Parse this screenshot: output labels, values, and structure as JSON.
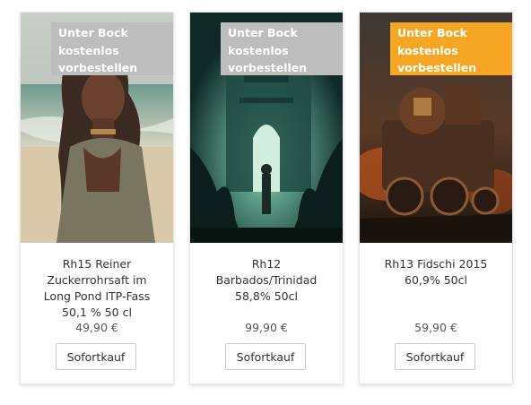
{
  "products": [
    {
      "badge_lines": [
        "Unter Bock",
        "kostenlos",
        "vorbestellen"
      ],
      "badge_color": "#bdbdbd",
      "title_lines": [
        "Rh15 Reiner",
        "Zuckerrohrsaft im",
        "Long Pond ITP-Fass",
        "50,1 % 50 cl"
      ],
      "price": "49,90 €",
      "button_label": "Sofortkauf"
    },
    {
      "badge_lines": [
        "Unter Bock",
        "kostenlos",
        "vorbestellen"
      ],
      "badge_color": "#bdbdbd",
      "title_lines": [
        "Rh12",
        "Barbados/Trinidad",
        "58,8% 50cl"
      ],
      "price": "99,90 €",
      "button_label": "Sofortkauf"
    },
    {
      "badge_lines": [
        "Unter Bock",
        "kostenlos",
        "vorbestellen"
      ],
      "badge_color": "#f5a623",
      "title_lines": [
        "Rh13 Fidschi 2015",
        "60,9% 50cl"
      ],
      "price": "59,90 €",
      "button_label": "Sofortkauf"
    }
  ]
}
